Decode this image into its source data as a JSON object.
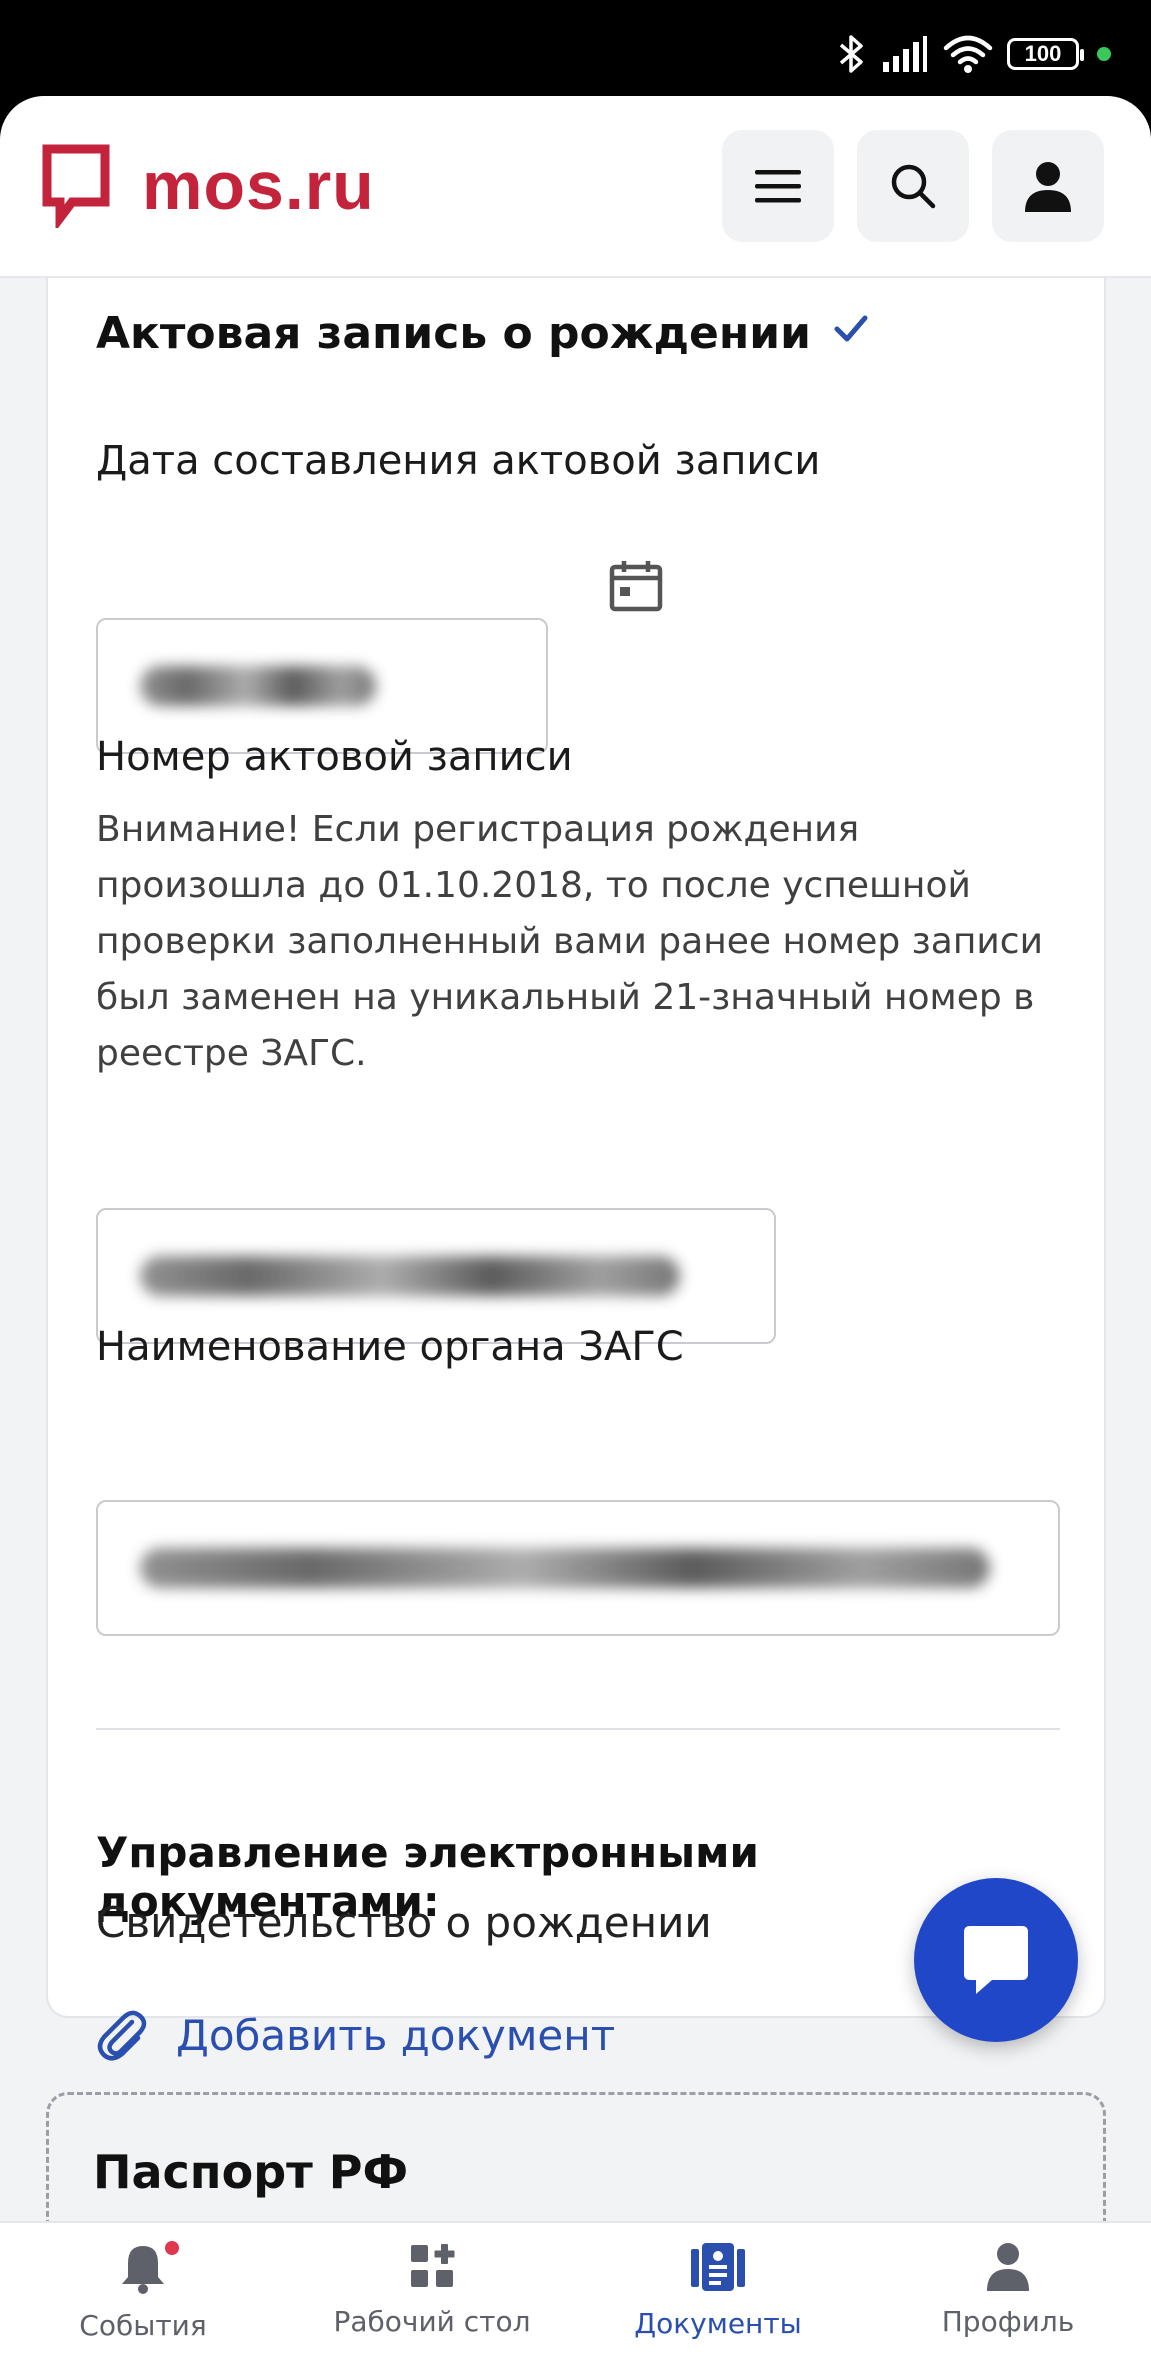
{
  "status_bar": {
    "battery": "100"
  },
  "header": {
    "logo_text": "mos.ru",
    "menu_icon": "hamburger-icon",
    "search_icon": "search-icon",
    "profile_icon": "user-icon"
  },
  "card": {
    "title": "Актовая запись о рождении",
    "date_label": "Дата составления актовой записи",
    "date_value": "",
    "number_label": "Номер актовой записи",
    "number_hint": "Внимание! Если регистрация рождения произошла до 01.10.2018, то после успешной проверки заполненный вами ранее номер записи был заменен на уникальный 21-значный номер в реестре ЗАГС.",
    "number_value": "",
    "zags_label": "Наименование органа ЗАГС",
    "zags_value": "",
    "edocs_heading": "Управление электронными документами:",
    "edocs_subheading": "Свидетельство о рождении",
    "add_document": "Добавить документ"
  },
  "passport": {
    "title": "Паспорт РФ"
  },
  "bottom_nav": {
    "items": [
      {
        "label": "События",
        "icon": "bell-icon"
      },
      {
        "label": "Рабочий стол",
        "icon": "widgets-icon"
      },
      {
        "label": "Документы",
        "icon": "documents-icon"
      },
      {
        "label": "Профиль",
        "icon": "person-icon"
      }
    ],
    "active": "Документы"
  },
  "colors": {
    "brand_red": "#c3243c",
    "accent_blue": "#2147c9",
    "link_blue": "#2a4fae"
  }
}
